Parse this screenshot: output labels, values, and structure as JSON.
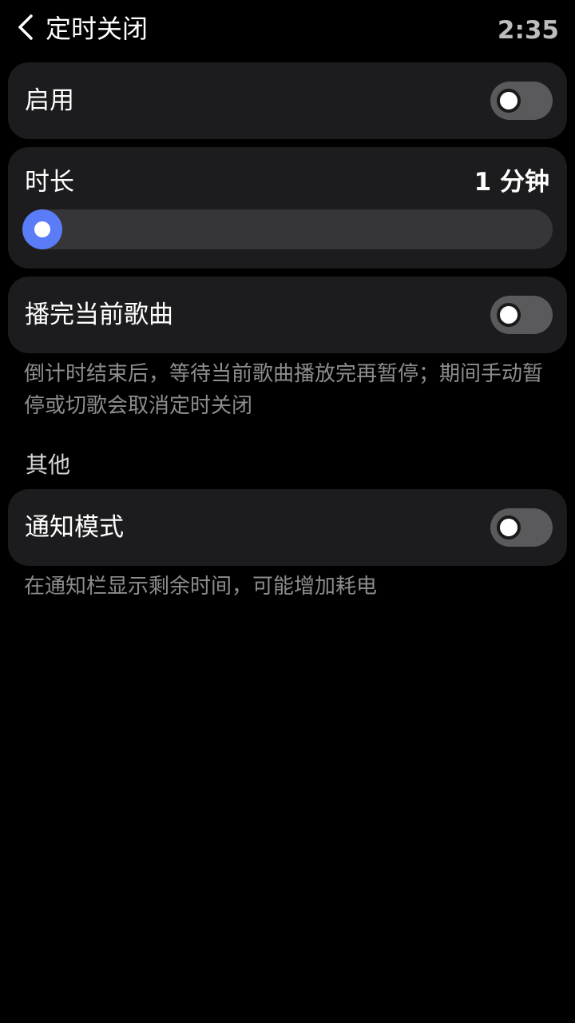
{
  "header": {
    "back_icon": "chevron-left-icon",
    "title": "定时关闭",
    "clock": "2:35"
  },
  "enable_row": {
    "label": "启用",
    "toggle_on": false
  },
  "duration_card": {
    "label": "时长",
    "value_text": "1 分钟",
    "slider_fraction": 0.0,
    "accent_color": "#5b7cf7"
  },
  "finish_song_row": {
    "label": "播完当前歌曲",
    "toggle_on": false,
    "description": "倒计时结束后，等待当前歌曲播放完再暂停；期间手动暂停或切歌会取消定时关闭"
  },
  "other_section": {
    "heading": "其他"
  },
  "notify_row": {
    "label": "通知模式",
    "toggle_on": false,
    "description": "在通知栏显示剩余时间，可能增加耗电"
  }
}
